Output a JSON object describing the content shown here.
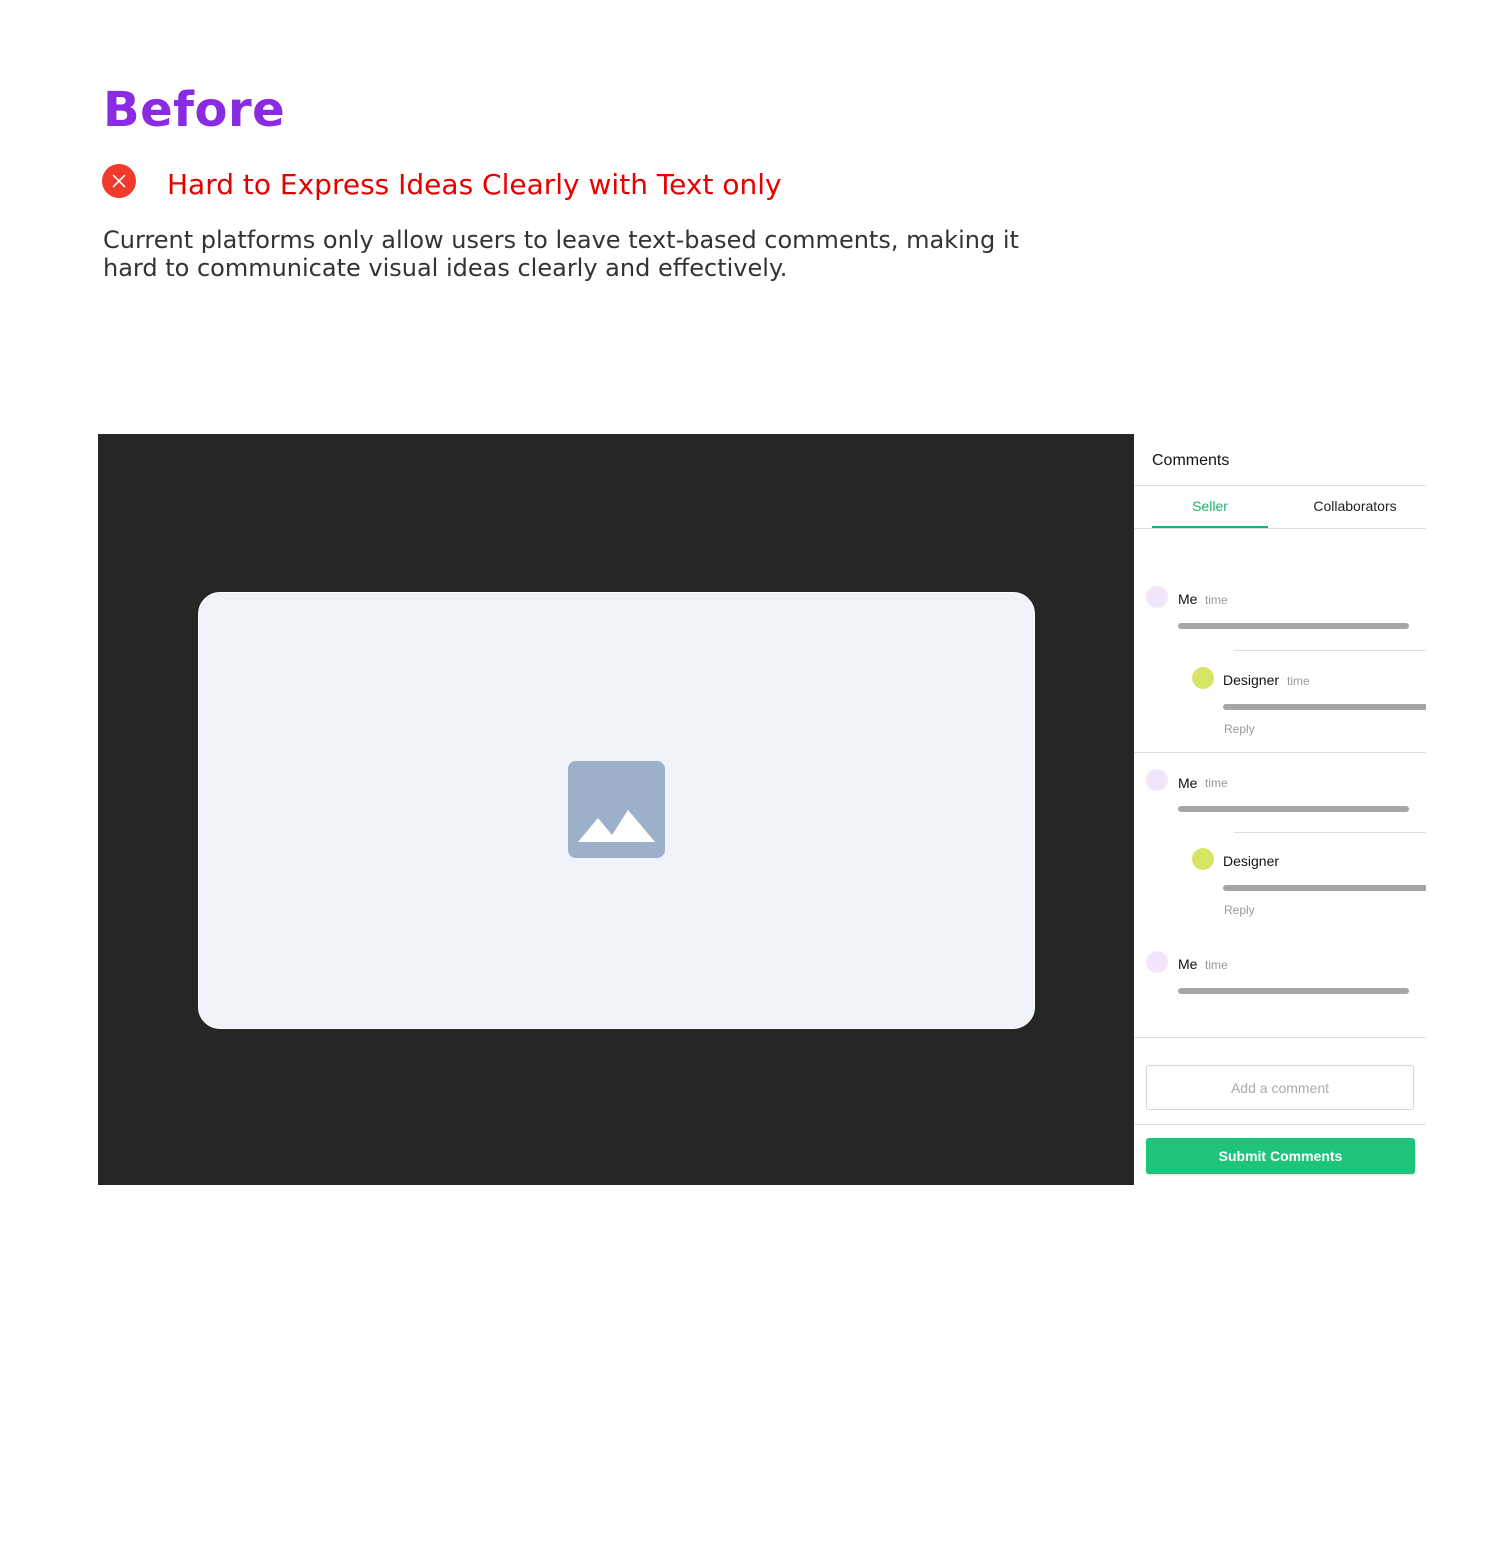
{
  "header": {
    "title": "Before",
    "problem_title": "Hard to Express Ideas Clearly with Text only",
    "description": "Current platforms only allow users to leave text-based comments, making it hard to communicate visual ideas clearly and effectively."
  },
  "panel": {
    "title": "Comments",
    "tabs": [
      {
        "label": "Seller",
        "active": true
      },
      {
        "label": "Collaborators",
        "active": false
      }
    ],
    "threads": [
      {
        "author": "Me",
        "time": "time",
        "reply": {
          "author": "Designer",
          "time": "time",
          "reply_label": "Reply"
        }
      },
      {
        "author": "Me",
        "time": "time",
        "reply": {
          "author": "Designer",
          "reply_label": "Reply"
        }
      },
      {
        "author": "Me",
        "time": "time"
      }
    ],
    "input_placeholder": "Add a comment",
    "submit_label": "Submit Comments"
  },
  "icons": {
    "problem": "close-circle-icon",
    "media": "image-placeholder-icon"
  },
  "colors": {
    "heading": "#8a2be2",
    "problem": "#e60000",
    "accent": "#1db36b",
    "submit": "#1dc47a",
    "viewer_bg": "#262626",
    "canvas_bg": "#eff2f7"
  }
}
